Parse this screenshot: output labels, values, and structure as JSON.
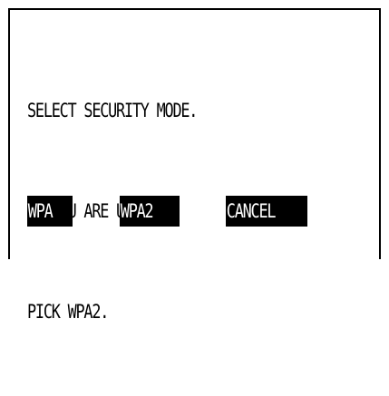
{
  "dialog": {
    "message_lines": [
      "SELECT SECURITY MODE.",
      "IF YOU ARE UNSURE,",
      "PICK WPA2."
    ]
  },
  "options": {
    "wpa": "WPA",
    "wpa2": "WPA2",
    "cancel": "CANCEL"
  },
  "colors": {
    "background": "#ffffff",
    "foreground": "#000000",
    "highlight_background": "#000000",
    "highlight_text": "#ffffff"
  }
}
